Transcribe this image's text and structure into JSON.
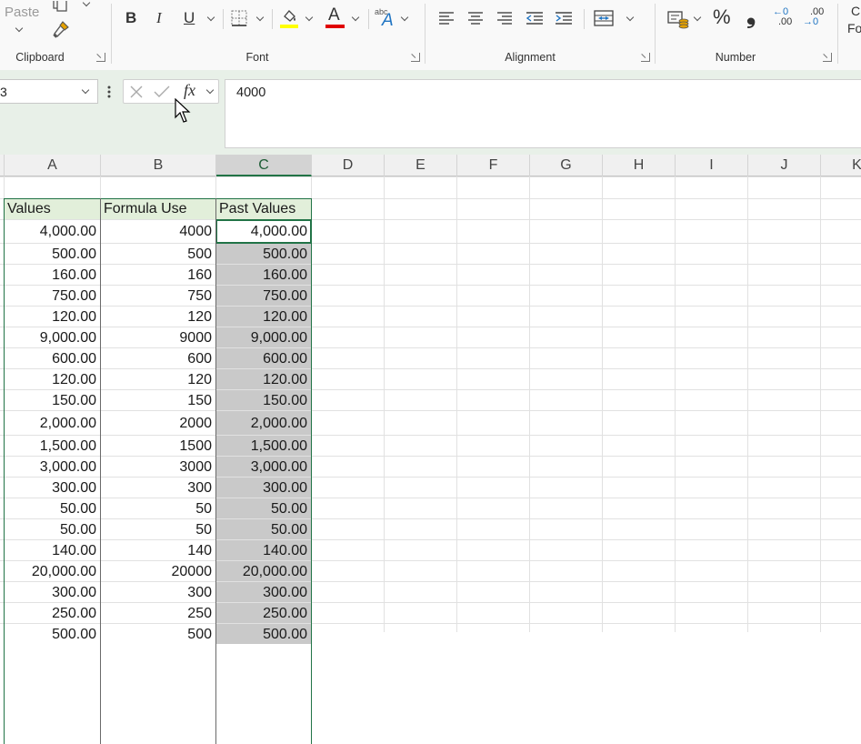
{
  "ribbon": {
    "paste_label": "Paste",
    "groups": {
      "clipboard": "Clipboard",
      "font": "Font",
      "alignment": "Alignment",
      "number": "Number"
    },
    "bold": "B",
    "italic": "I",
    "underline": "U",
    "font_color_glyph": "A",
    "abc_glyph": "abc",
    "percent": "%",
    "comma": "❟",
    "inc_decimal_top": "←0",
    "inc_decimal_bottom": ".00",
    "dec_decimal_top": ".00",
    "dec_decimal_bottom": "→0",
    "cond_format_partial_top": "C",
    "cond_format_partial_bottom": "Fo",
    "accent_colors": {
      "highlight": "#ffff00",
      "font_color": "#e00000",
      "excel_green": "#217346"
    }
  },
  "formula_bar": {
    "name_box": "3",
    "fx_label": "fx",
    "value": "4000"
  },
  "columns": [
    "A",
    "B",
    "C",
    "D",
    "E",
    "F",
    "G",
    "H",
    "I",
    "J",
    "K"
  ],
  "table": {
    "headers": [
      "Values",
      "Formula Use",
      "Past Values"
    ],
    "rows": [
      [
        "4,000.00",
        "4000",
        "4,000.00"
      ],
      [
        "500.00",
        "500",
        "500.00"
      ],
      [
        "160.00",
        "160",
        "160.00"
      ],
      [
        "750.00",
        "750",
        "750.00"
      ],
      [
        "120.00",
        "120",
        "120.00"
      ],
      [
        "9,000.00",
        "9000",
        "9,000.00"
      ],
      [
        "600.00",
        "600",
        "600.00"
      ],
      [
        "120.00",
        "120",
        "120.00"
      ],
      [
        "150.00",
        "150",
        "150.00"
      ],
      [
        "2,000.00",
        "2000",
        "2,000.00"
      ],
      [
        "1,500.00",
        "1500",
        "1,500.00"
      ],
      [
        "3,000.00",
        "3000",
        "3,000.00"
      ],
      [
        "300.00",
        "300",
        "300.00"
      ],
      [
        "50.00",
        "50",
        "50.00"
      ],
      [
        "50.00",
        "50",
        "50.00"
      ],
      [
        "140.00",
        "140",
        "140.00"
      ],
      [
        "20,000.00",
        "20000",
        "20,000.00"
      ],
      [
        "300.00",
        "300",
        "300.00"
      ],
      [
        "250.00",
        "250",
        "250.00"
      ],
      [
        "500.00",
        "500",
        "500.00"
      ]
    ]
  }
}
